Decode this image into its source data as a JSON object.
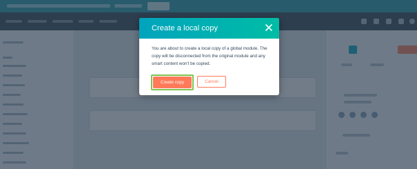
{
  "modal": {
    "title": "Create a local copy",
    "message": "You are about to create a local copy of a global module. The copy will be disconnected from the original module and any smart content won't be copied.",
    "primary_label": "Create copy",
    "secondary_label": "Cancel",
    "close_icon": "close-icon"
  },
  "colors": {
    "header_start": "#00a4bd",
    "header_end": "#00bda5",
    "primary": "#ff7a59",
    "focus_ring": "#7fc34e",
    "text": "#33475b"
  }
}
